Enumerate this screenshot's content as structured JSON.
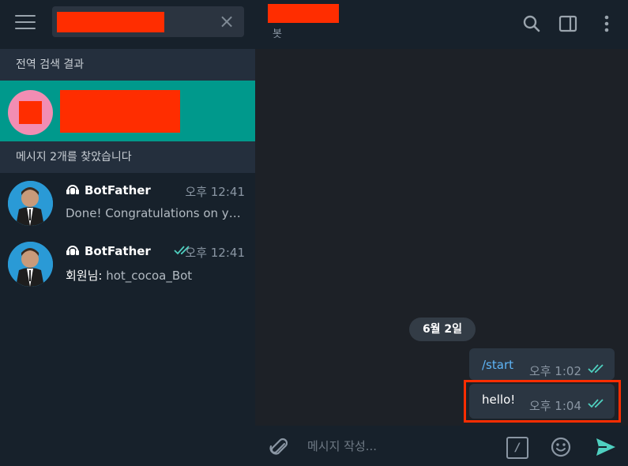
{
  "search": {
    "clear_icon": "×"
  },
  "sidebar": {
    "global_results_header": "전역 검색 결과",
    "messages_found_header": "메시지 2개를 찾았습니다",
    "results": [
      {
        "name": "BotFather",
        "time": "오후 12:41",
        "preview": "Done! Congratulations on your new bot.",
        "read": false
      },
      {
        "name": "BotFather",
        "time": "오후 12:41",
        "preview_prefix": "회원님:",
        "preview": " hot_cocoa_Bot",
        "read": true
      }
    ]
  },
  "chat": {
    "subtitle": "봇",
    "date_separator": "6월 2일",
    "messages": [
      {
        "text": "/start",
        "time": "오후 1:02"
      },
      {
        "text": "hello!",
        "time": "오후 1:04"
      }
    ],
    "composer": {
      "placeholder": "메시지 작성...",
      "command_icon": "/"
    }
  },
  "colors": {
    "accent": "#00998c",
    "link": "#5eb5f7",
    "read_check": "#4fd0c0",
    "redaction": "#ff2d00"
  }
}
